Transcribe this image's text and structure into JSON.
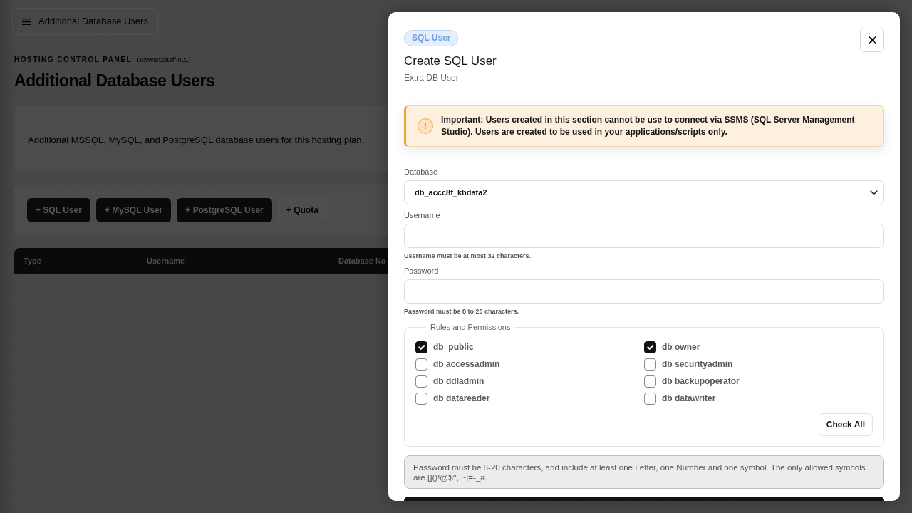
{
  "page": {
    "nav_title": "Additional Database Users",
    "eyebrow": "HOSTING CONTROL PANEL",
    "account": "(Joywan2staff-001)",
    "heading": "Additional Database Users",
    "description": "Additional MSSQL, MySQL, and PostgreSQL database users for this hosting plan.",
    "buttons": [
      {
        "label": "+ SQL User",
        "kind": "solid"
      },
      {
        "label": "+ MySQL User",
        "kind": "solid"
      },
      {
        "label": "+ PostgreSQL User",
        "kind": "solid"
      },
      {
        "label": "+ Quota",
        "kind": "outline"
      }
    ],
    "table": {
      "columns": [
        "Type",
        "Username",
        "Database Na"
      ]
    }
  },
  "modal": {
    "badge": "SQL User",
    "title": "Create SQL User",
    "subtitle": "Extra DB User",
    "alert": "Important: Users created in this section cannot be use to connect via SSMS (SQL Server Management Studio). Users are created to be used in your applications/scripts only.",
    "fields": [
      {
        "label": "Database",
        "kind": "select",
        "value": "db_accc8f_kbdata2"
      },
      {
        "label": "Username",
        "kind": "text",
        "help": "Username must be at most 32 characters."
      },
      {
        "label": "Password",
        "kind": "password",
        "help": "Password must be 8 to 20 characters."
      }
    ],
    "roles": {
      "legend": "Roles and Permissions",
      "items": [
        {
          "label": "db_public",
          "checked": true
        },
        {
          "label": "db owner",
          "checked": true
        },
        {
          "label": "db accessadmin",
          "checked": false
        },
        {
          "label": "db securityadmin",
          "checked": false
        },
        {
          "label": "db ddladmin",
          "checked": false
        },
        {
          "label": "db backupoperator",
          "checked": false
        },
        {
          "label": "db datareader",
          "checked": false
        },
        {
          "label": "db datawriter",
          "checked": false
        }
      ],
      "button": "Check All"
    },
    "note": "Password must be 8-20 characters, and include at least one Letter, one Number and one symbol. The only allowed symbols are []()!@$^,.~|=-_#."
  }
}
